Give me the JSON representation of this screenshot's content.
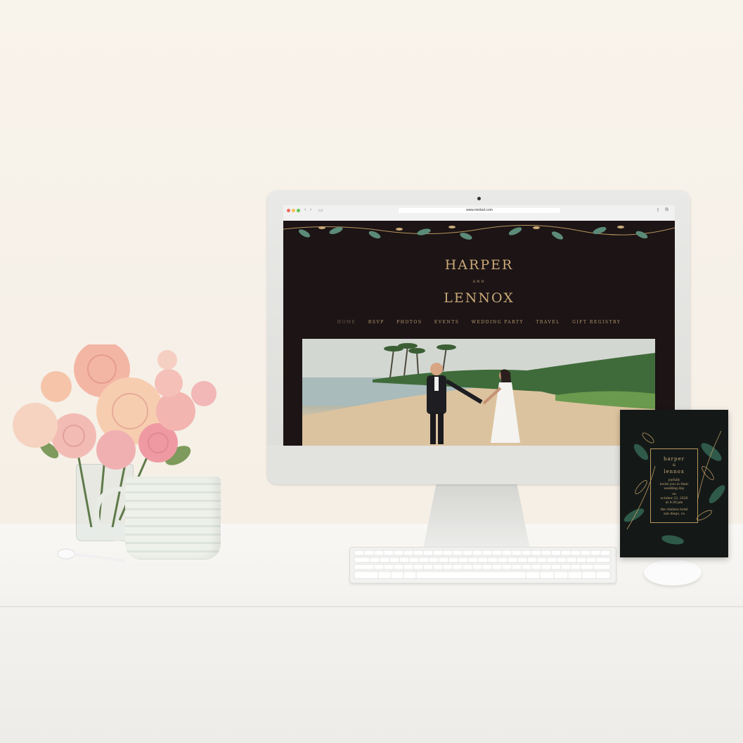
{
  "browser": {
    "url": "www.minted.com",
    "window_dots": [
      "#ee6a5f",
      "#f5be4f",
      "#62c554"
    ]
  },
  "website": {
    "name_top": "HARPER",
    "conjunction": "AND",
    "name_bottom": "LENNOX",
    "nav": [
      {
        "label": "HOME",
        "active": true
      },
      {
        "label": "RSVP"
      },
      {
        "label": "PHOTOS"
      },
      {
        "label": "EVENTS"
      },
      {
        "label": "WEDDING PARTY"
      },
      {
        "label": "TRAVEL"
      },
      {
        "label": "GIFT REGISTRY"
      }
    ],
    "accent_color": "#c9a978",
    "background_color": "#1c1415"
  },
  "invitation": {
    "line1": "harper",
    "line2": "&",
    "line3": "lennox",
    "line4": "joyfully",
    "line5": "invite you to their",
    "line6": "wedding day",
    "line7": "on",
    "line8": "october 22, 2026",
    "line9": "at 4:30 pm",
    "line10": "the chelsea hotel",
    "line11": "san diego, ca"
  }
}
